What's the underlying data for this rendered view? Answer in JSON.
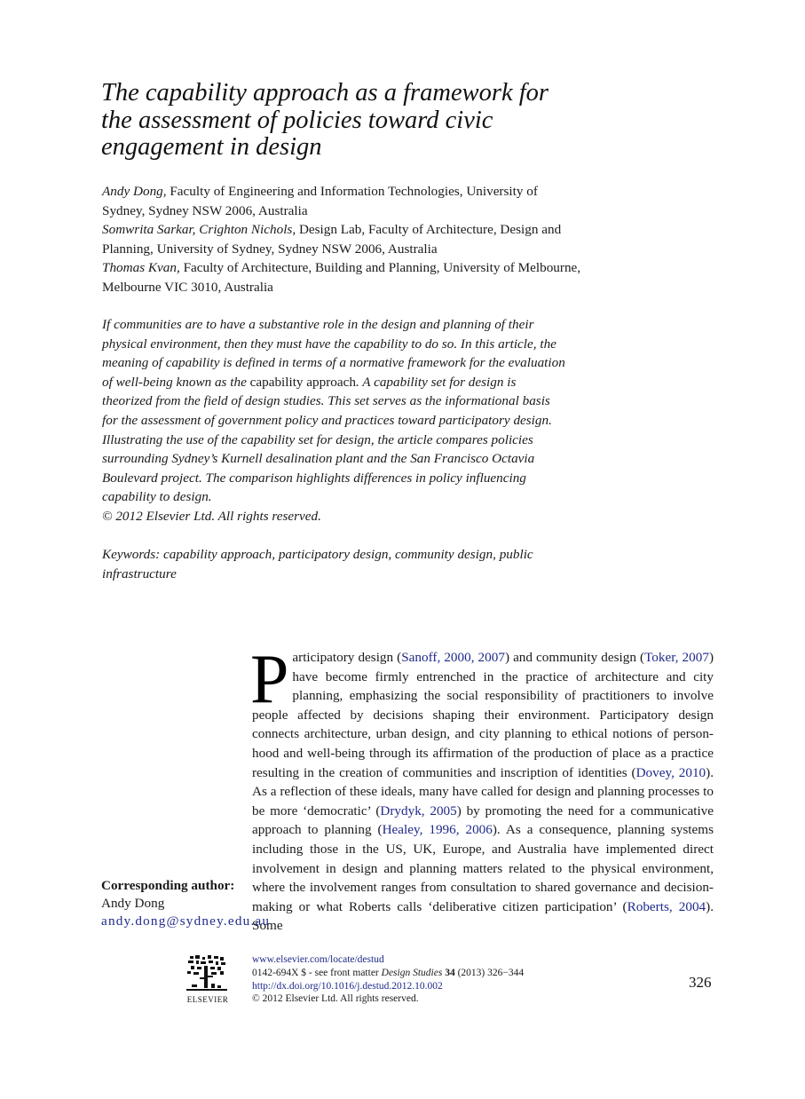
{
  "article": {
    "title": "The capability approach as a framework for the assessment of policies toward civic engagement in design",
    "authors": [
      {
        "names": "Andy Dong,",
        "affiliation": " Faculty of Engineering and Information Technologies, University of Sydney, Sydney NSW 2006, Australia"
      },
      {
        "names": "Somwrita Sarkar, Crighton Nichols,",
        "affiliation": " Design Lab, Faculty of Architecture, Design and Planning, University of Sydney, Sydney NSW 2006, Australia"
      },
      {
        "names": "Thomas Kvan,",
        "affiliation": " Faculty of Architecture, Building and Planning, University of Melbourne, Melbourne VIC 3010, Australia"
      }
    ],
    "abstract": {
      "part1": "If communities are to have a substantive role in the design and planning of their physical environment, then they must have the capability to do so. In this article, the meaning of capability is defined in terms of a normative framework for the evaluation of well-being known as the ",
      "term": "capability approach",
      "part2": ". A capability set for design is theorized from the field of design studies. This set serves as the informational basis for the assessment of government policy and practices toward participatory design. Illustrating the use of the capability set for design, the article compares policies surrounding Sydney’s Kurnell desalination plant and the San Francisco Octavia Boulevard project. The comparison highlights differences in policy influencing capability to design.",
      "copyright": "© 2012 Elsevier Ltd. All rights reserved."
    },
    "keywords": "Keywords: capability approach, participatory design, community design, public infrastructure"
  },
  "body": {
    "dropcap": "P",
    "segments": [
      {
        "text": "articipatory design (",
        "link": false
      },
      {
        "text": "Sanoff, 2000, 2007",
        "link": true
      },
      {
        "text": ") and community design (",
        "link": false
      },
      {
        "text": "Toker, 2007",
        "link": true
      },
      {
        "text": ") have become firmly entrenched in the practice of architecture and city planning, emphasizing the social responsibility of practitioners to involve people affected by decisions shaping their environment. Participatory design connects architecture, urban design, and city planning to ethical notions of person-hood and well-being through its affirmation of the production of place as a practice resulting in the creation of communities and inscription of identities (",
        "link": false
      },
      {
        "text": "Dovey, 2010",
        "link": true
      },
      {
        "text": "). As a reflection of these ideals, many have called for design and planning processes to be more ‘democratic’ (",
        "link": false
      },
      {
        "text": "Drydyk, 2005",
        "link": true
      },
      {
        "text": ") by promoting the need for a communicative approach to planning (",
        "link": false
      },
      {
        "text": "Healey, 1996, 2006",
        "link": true
      },
      {
        "text": "). As a consequence, planning systems including those in the US, UK, Europe, and Australia have implemented direct involvement in design and planning matters related to the physical environment, where the involvement ranges from consultation to shared governance and decision-making or what Roberts calls ‘deliberative citizen participation’ (",
        "link": false
      },
      {
        "text": "Roberts, 2004",
        "link": true
      },
      {
        "text": "). Some",
        "link": false
      }
    ]
  },
  "corresponding_author": {
    "label": "Corresponding author:",
    "name": "Andy Dong",
    "email": "andy.dong@sydney.edu.au"
  },
  "footer": {
    "logo_wordmark": "ELSEVIER",
    "journal_url": "www.elsevier.com/locate/destud",
    "issn_prefix": "0142-694X $ - see front matter ",
    "journal_name": "Design Studies",
    "volume": "34",
    "year_pages": " (2013) 326−344",
    "doi": "http://dx.doi.org/10.1016/j.destud.2012.10.002",
    "copyright": "© 2012 Elsevier Ltd. All rights reserved."
  },
  "page_number": "326",
  "colors": {
    "link": "#1f2a8a",
    "text": "#1a1a1a"
  }
}
